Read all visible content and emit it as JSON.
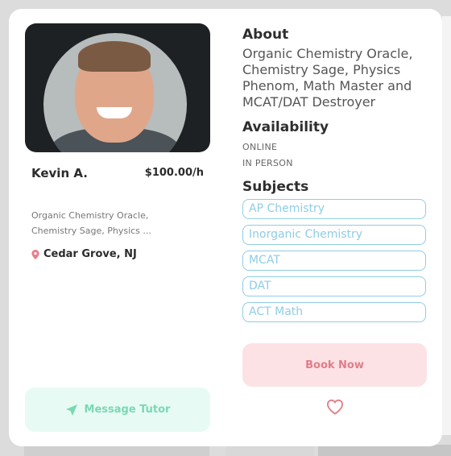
{
  "tutor": {
    "name": "Kevin A.",
    "price": "$100.00/h",
    "tagline": "Organic Chemistry Oracle, Chemistry Sage, Physics ...",
    "location": "Cedar Grove, NJ",
    "message_button": "Message Tutor"
  },
  "about": {
    "title": "About",
    "text": "Organic Chemistry Oracle, Chemistry Sage, Physics Phenom, Math Master and MCAT/DAT Destroyer"
  },
  "availability": {
    "title": "Availability",
    "items": [
      "ONLINE",
      "IN PERSON"
    ]
  },
  "subjects": {
    "title": "Subjects",
    "items": [
      "AP Chemistry",
      "Inorganic Chemistry",
      "MCAT",
      "DAT",
      "ACT Math"
    ]
  },
  "actions": {
    "book_label": "Book Now"
  },
  "colors": {
    "accent_teal": "#79d9b4",
    "accent_pink": "#e07e89",
    "subject_border": "#8fcde4"
  },
  "icons": {
    "location": "map-pin-icon",
    "message": "send-icon",
    "favorite": "heart-icon"
  }
}
